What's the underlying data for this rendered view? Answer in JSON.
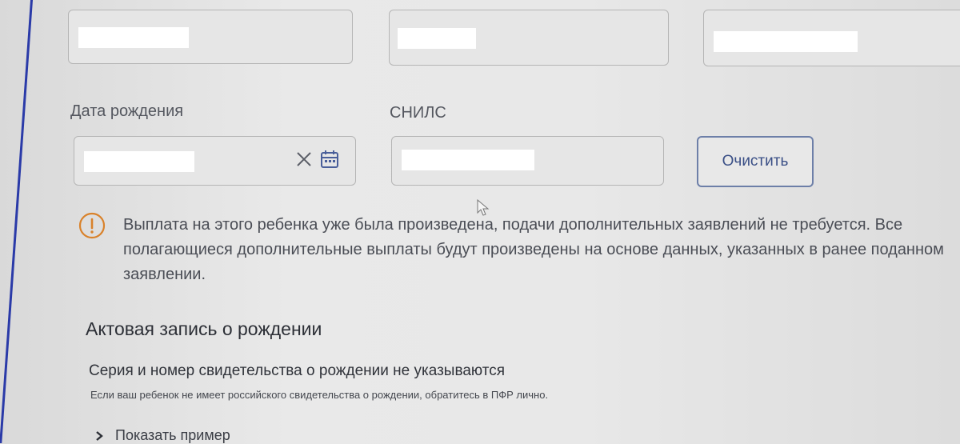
{
  "form": {
    "birth_date_label": "Дата рождения",
    "snils_label": "СНИЛС",
    "clear_button": "Очистить"
  },
  "notice": {
    "text": "Выплата на этого ребенка уже была произведена, подачи дополнительных заявлений не требуется. Все полагающиеся дополнительные выплаты будут произведены на основе данных, указанных в ранее поданном заявлении."
  },
  "birth_record": {
    "title": "Актовая запись о рождении",
    "certificate_note": "Серия и номер свидетельства о рождении не указываются",
    "hint": "Если ваш ребенок не имеет российского свидетельства о рождении, обратитесь в ПФР лично.",
    "show_example": "Показать пример"
  },
  "colors": {
    "accent_blue": "#2a3aa8",
    "warning_orange": "#d9822b",
    "button_text": "#3a4f86"
  }
}
